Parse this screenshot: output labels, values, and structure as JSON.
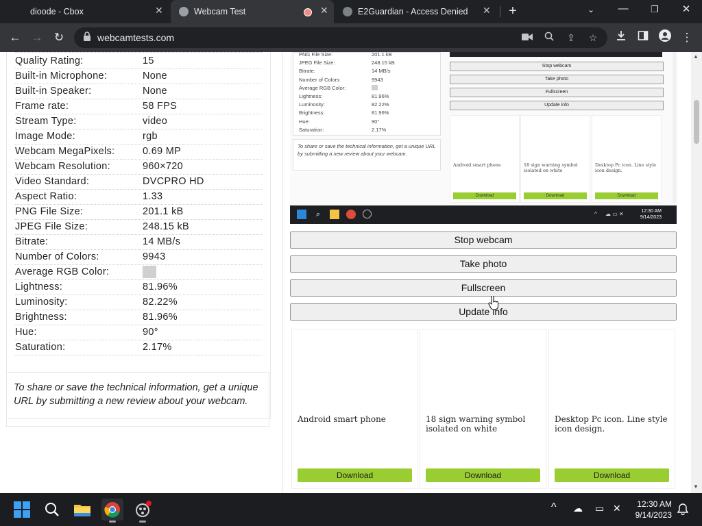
{
  "browser": {
    "tabs": [
      {
        "title": "dioode - Cbox",
        "active": false
      },
      {
        "title": "Webcam Test",
        "active": true
      },
      {
        "title": "E2Guardian - Access Denied",
        "active": false
      }
    ],
    "url": "webcamtests.com"
  },
  "specs": [
    {
      "label": "Quality Rating:",
      "value": "15"
    },
    {
      "label": "Built-in Microphone:",
      "value": "None"
    },
    {
      "label": "Built-in Speaker:",
      "value": "None"
    },
    {
      "label": "Frame rate:",
      "value": "58 FPS"
    },
    {
      "label": "Stream Type:",
      "value": "video"
    },
    {
      "label": "Image Mode:",
      "value": "rgb"
    },
    {
      "label": "Webcam MegaPixels:",
      "value": "0.69 MP"
    },
    {
      "label": "Webcam Resolution:",
      "value": "960×720"
    },
    {
      "label": "Video Standard:",
      "value": "DVCPRO HD"
    },
    {
      "label": "Aspect Ratio:",
      "value": "1.33"
    },
    {
      "label": "PNG File Size:",
      "value": "201.1 kB"
    },
    {
      "label": "JPEG File Size:",
      "value": "248.15 kB"
    },
    {
      "label": "Bitrate:",
      "value": "14 MB/s"
    },
    {
      "label": "Number of Colors:",
      "value": "9943"
    },
    {
      "label": "Average RGB Color:",
      "value": ""
    },
    {
      "label": "Lightness:",
      "value": "81.96%"
    },
    {
      "label": "Luminosity:",
      "value": "82.22%"
    },
    {
      "label": "Brightness:",
      "value": "81.96%"
    },
    {
      "label": "Hue:",
      "value": "90°"
    },
    {
      "label": "Saturation:",
      "value": "2.17%"
    }
  ],
  "share_text": "To share or save the technical information, get a unique URL by submitting a new review about your webcam.",
  "buttons": {
    "stop": "Stop webcam",
    "photo": "Take photo",
    "fullscreen": "Fullscreen",
    "update": "Update info"
  },
  "cards": [
    {
      "title": "Android smart phone",
      "download": "Download"
    },
    {
      "title": "18 sign warning symbol isolated on white",
      "download": "Download"
    },
    {
      "title": "Desktop Pc icon. Line style icon design.",
      "download": "Download"
    }
  ],
  "video_frame": {
    "specs": [
      {
        "label": "PNG File Size:",
        "value": "201.1 kB"
      },
      {
        "label": "JPEG File Size:",
        "value": "248.15 kB"
      },
      {
        "label": "Bitrate:",
        "value": "14 MB/s"
      },
      {
        "label": "Number of Colors:",
        "value": "9943"
      },
      {
        "label": "Average RGB Color:",
        "value": ""
      },
      {
        "label": "Lightness:",
        "value": "81.96%"
      },
      {
        "label": "Luminosity:",
        "value": "82.22%"
      },
      {
        "label": "Brightness:",
        "value": "81.96%"
      },
      {
        "label": "Hue:",
        "value": "90°"
      },
      {
        "label": "Saturation:",
        "value": "2.17%"
      }
    ],
    "share_text": "To share or save the technical information, get a unique URL by submitting a new review about your webcam.",
    "buttons": [
      "Stop webcam",
      "Take photo",
      "Fullscreen",
      "Update info"
    ],
    "cards": [
      "Android smart phone",
      "18 sign warning symbol isolated on white",
      "Desktop Pc icon. Line style icon design."
    ],
    "download": "Download",
    "clock_time": "12:30 AM",
    "clock_date": "9/14/2023"
  },
  "taskbar": {
    "time": "12:30 AM",
    "date": "9/14/2023"
  },
  "colors": {
    "download_green": "#9acd32",
    "tab_strip": "#202124",
    "toolbar": "#35363a"
  }
}
